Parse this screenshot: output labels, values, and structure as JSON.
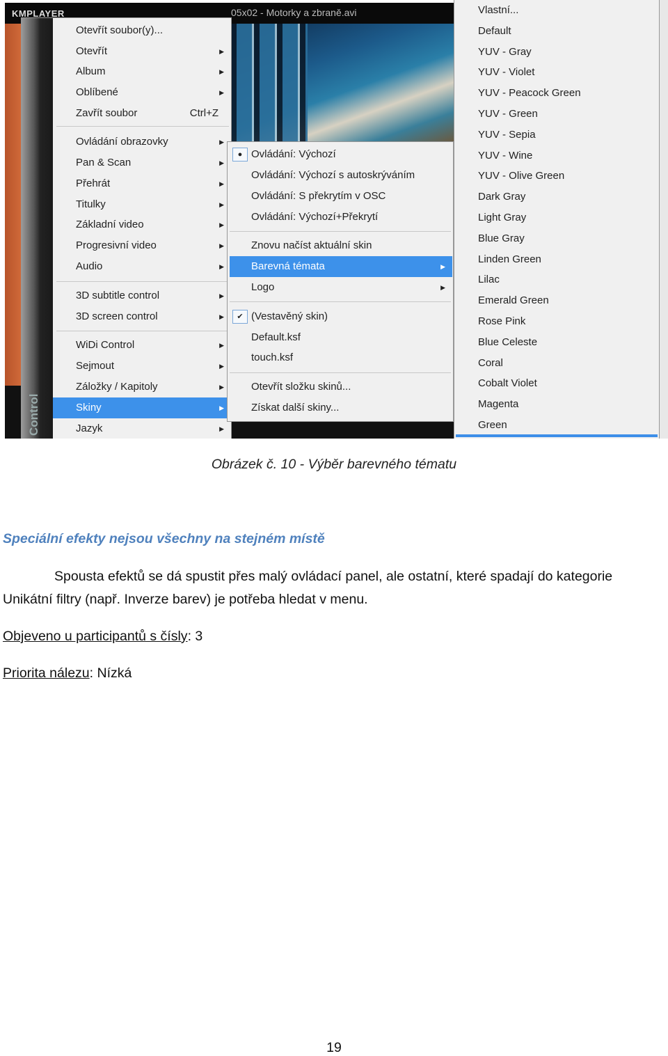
{
  "screenshot": {
    "app_logo": "KMPLAYER",
    "file_title": "05x02 - Motorky a zbraně.avi",
    "sidebar_label": "Control",
    "main_menu": [
      {
        "label": "Otevřít soubor(y)...",
        "arrow": false
      },
      {
        "label": "Otevřít",
        "arrow": true
      },
      {
        "label": "Album",
        "arrow": true
      },
      {
        "label": "Oblíbené",
        "arrow": true
      },
      {
        "label": "Zavřít soubor",
        "shortcut": "Ctrl+Z",
        "arrow": false
      },
      {
        "label": "Ovládání obrazovky",
        "arrow": true
      },
      {
        "label": "Pan & Scan",
        "arrow": true
      },
      {
        "label": "Přehrát",
        "arrow": true
      },
      {
        "label": "Titulky",
        "arrow": true
      },
      {
        "label": "Základní video",
        "arrow": true
      },
      {
        "label": "Progresivní video",
        "arrow": true
      },
      {
        "label": "Audio",
        "arrow": true
      },
      {
        "label": "3D subtitle control",
        "arrow": true
      },
      {
        "label": "3D screen control",
        "arrow": true
      },
      {
        "label": "WiDi Control",
        "arrow": true
      },
      {
        "label": "Sejmout",
        "arrow": true
      },
      {
        "label": "Záložky / Kapitoly",
        "arrow": true
      },
      {
        "label": "Skiny",
        "arrow": true,
        "highlighted": true
      },
      {
        "label": "Jazyk",
        "arrow": true
      }
    ],
    "skins_menu": [
      {
        "label": "Ovládání: Výchozí",
        "mark": "radio"
      },
      {
        "label": "Ovládání: Výchozí s autoskrýváním"
      },
      {
        "label": "Ovládání: S překrytím v OSC"
      },
      {
        "label": "Ovládání: Výchozí+Překrytí"
      },
      {
        "label": "Znovu načíst aktuální skin"
      },
      {
        "label": "Barevná témata",
        "arrow": true,
        "highlighted": true
      },
      {
        "label": "Logo",
        "arrow": true
      },
      {
        "label": "(Vestavěný skin)",
        "mark": "check"
      },
      {
        "label": "Default.ksf"
      },
      {
        "label": "touch.ksf"
      },
      {
        "label": "Otevřít složku skinů..."
      },
      {
        "label": "Získat další skiny..."
      }
    ],
    "themes_menu": [
      "Vlastní...",
      "Default",
      "YUV - Gray",
      "YUV - Violet",
      "YUV - Peacock Green",
      "YUV - Green",
      "YUV - Sepia",
      "YUV - Wine",
      "YUV - Olive Green",
      "Dark Gray",
      "Light Gray",
      "Blue Gray",
      "Linden Green",
      "Lilac",
      "Emerald Green",
      "Rose Pink",
      "Blue Celeste",
      "Coral",
      "Cobalt Violet",
      "Magenta",
      "Green"
    ],
    "highlight_color": "#3d91ea"
  },
  "caption": "Obrázek č. 10 - Výběr barevného tématu",
  "heading": "Speciální efekty nejsou všechny na stejném místě",
  "heading_color": "#4f81bd",
  "paragraph_line1": "Spousta efektů se dá spustit přes malý ovládací panel, ale ostatní, které spadají do kategorie",
  "paragraph_line2": "Unikátní filtry (např. Inverze barev) je potřeba hledat v menu.",
  "found_label": "Objeveno u participantů s čísly",
  "found_value": ": 3",
  "priority_label": "Priorita nálezu",
  "priority_value": ": Nízká",
  "page_number": "19"
}
